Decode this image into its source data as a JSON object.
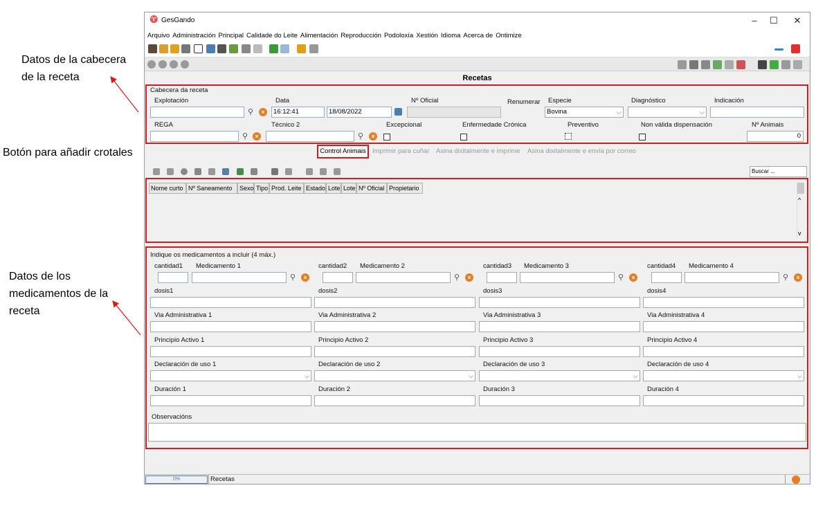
{
  "annotations": {
    "header_note": "Datos de la cabecera\nde la receta",
    "button_note": "Botón para añadir crotales",
    "meds_note": "Datos de los\nmedicamentos de la\nreceta"
  },
  "window": {
    "title": "GesGando",
    "min": "–",
    "max": "☐",
    "close": "✕"
  },
  "menu": [
    "Arquivo",
    "Administración",
    "Principal",
    "Calidade do Leite",
    "Alimentación",
    "Reproducción",
    "Podoloxía",
    "Xestión",
    "Idioma",
    "Acerca de",
    "Ontimize"
  ],
  "page_title": "Recetas",
  "header": {
    "group_label": "Cabecera da receta",
    "explotacion_label": "Explotación",
    "data_label": "Data",
    "time_value": "16:12:41",
    "date_value": "18/08/2022",
    "noficial_label": "Nº Oficial",
    "renumerar_label": "Renumerar",
    "especie_label": "Especie",
    "especie_value": "Bovina",
    "diagnostico_label": "Diagnóstico",
    "indicacion_label": "Indicación",
    "rega_label": "REGA",
    "tecnico2_label": "Técnico 2",
    "excepcional_label": "Excepcional",
    "cronica_label": "Enfermedade Crónica",
    "preventivo_label": "Preventivo",
    "nonvalida_label": "Non válida dispensación",
    "nanimais_label": "Nº Animais",
    "nanimais_value": "0"
  },
  "actions": {
    "control_animais": "Control Animais",
    "imprimir": "Imprimir para cuñar",
    "asina_imprime": "Asina dixitalmente e imprime",
    "asina_correo": "Asina dixitalmente e envía por correo"
  },
  "search": {
    "placeholder": "Buscar ..."
  },
  "table": {
    "columns": [
      "Nome curto",
      "Nº Saneamento",
      "Sexo",
      "Tipo",
      "Prod. Leite",
      "Estado",
      "Lote",
      "Lote",
      "Nº Oficial",
      "Propietario"
    ]
  },
  "meds": {
    "group_label": "Indique os medicamentos a incluir (4 máx.)",
    "cols": [
      {
        "cantidad": "cantidad1",
        "medicamento": "Medicamento 1",
        "dosis": "dosis1",
        "via": "Via Administrativa 1",
        "principio": "Principio Activo 1",
        "declaracion": "Declaración de uso 1",
        "duracion": "Duración 1"
      },
      {
        "cantidad": "cantidad2",
        "medicamento": "Medicamento 2",
        "dosis": "dosis2",
        "via": "Via Administrativa 2",
        "principio": "Principio Activo 2",
        "declaracion": "Declaración de uso 2",
        "duracion": "Duración 2"
      },
      {
        "cantidad": "cantidad3",
        "medicamento": "Medicamento 3",
        "dosis": "dosis3",
        "via": "Via Administrativa 3",
        "principio": "Principio Activo 3",
        "declaracion": "Declaración de uso 3",
        "duracion": "Duración 3"
      },
      {
        "cantidad": "cantidad4",
        "medicamento": "Medicamento 4",
        "dosis": "dosis4",
        "via": "Via Administrativa 4",
        "principio": "Principio Activo 4",
        "declaracion": "Declaración de uso 4",
        "duracion": "Duración 4"
      }
    ],
    "observacions_label": "Observacións"
  },
  "status": {
    "progress": "0%",
    "text": "Recetas"
  },
  "colors": {
    "annotation_red": "#d9191b",
    "field_border": "#8fb0c8",
    "orange": "#e67e22"
  }
}
